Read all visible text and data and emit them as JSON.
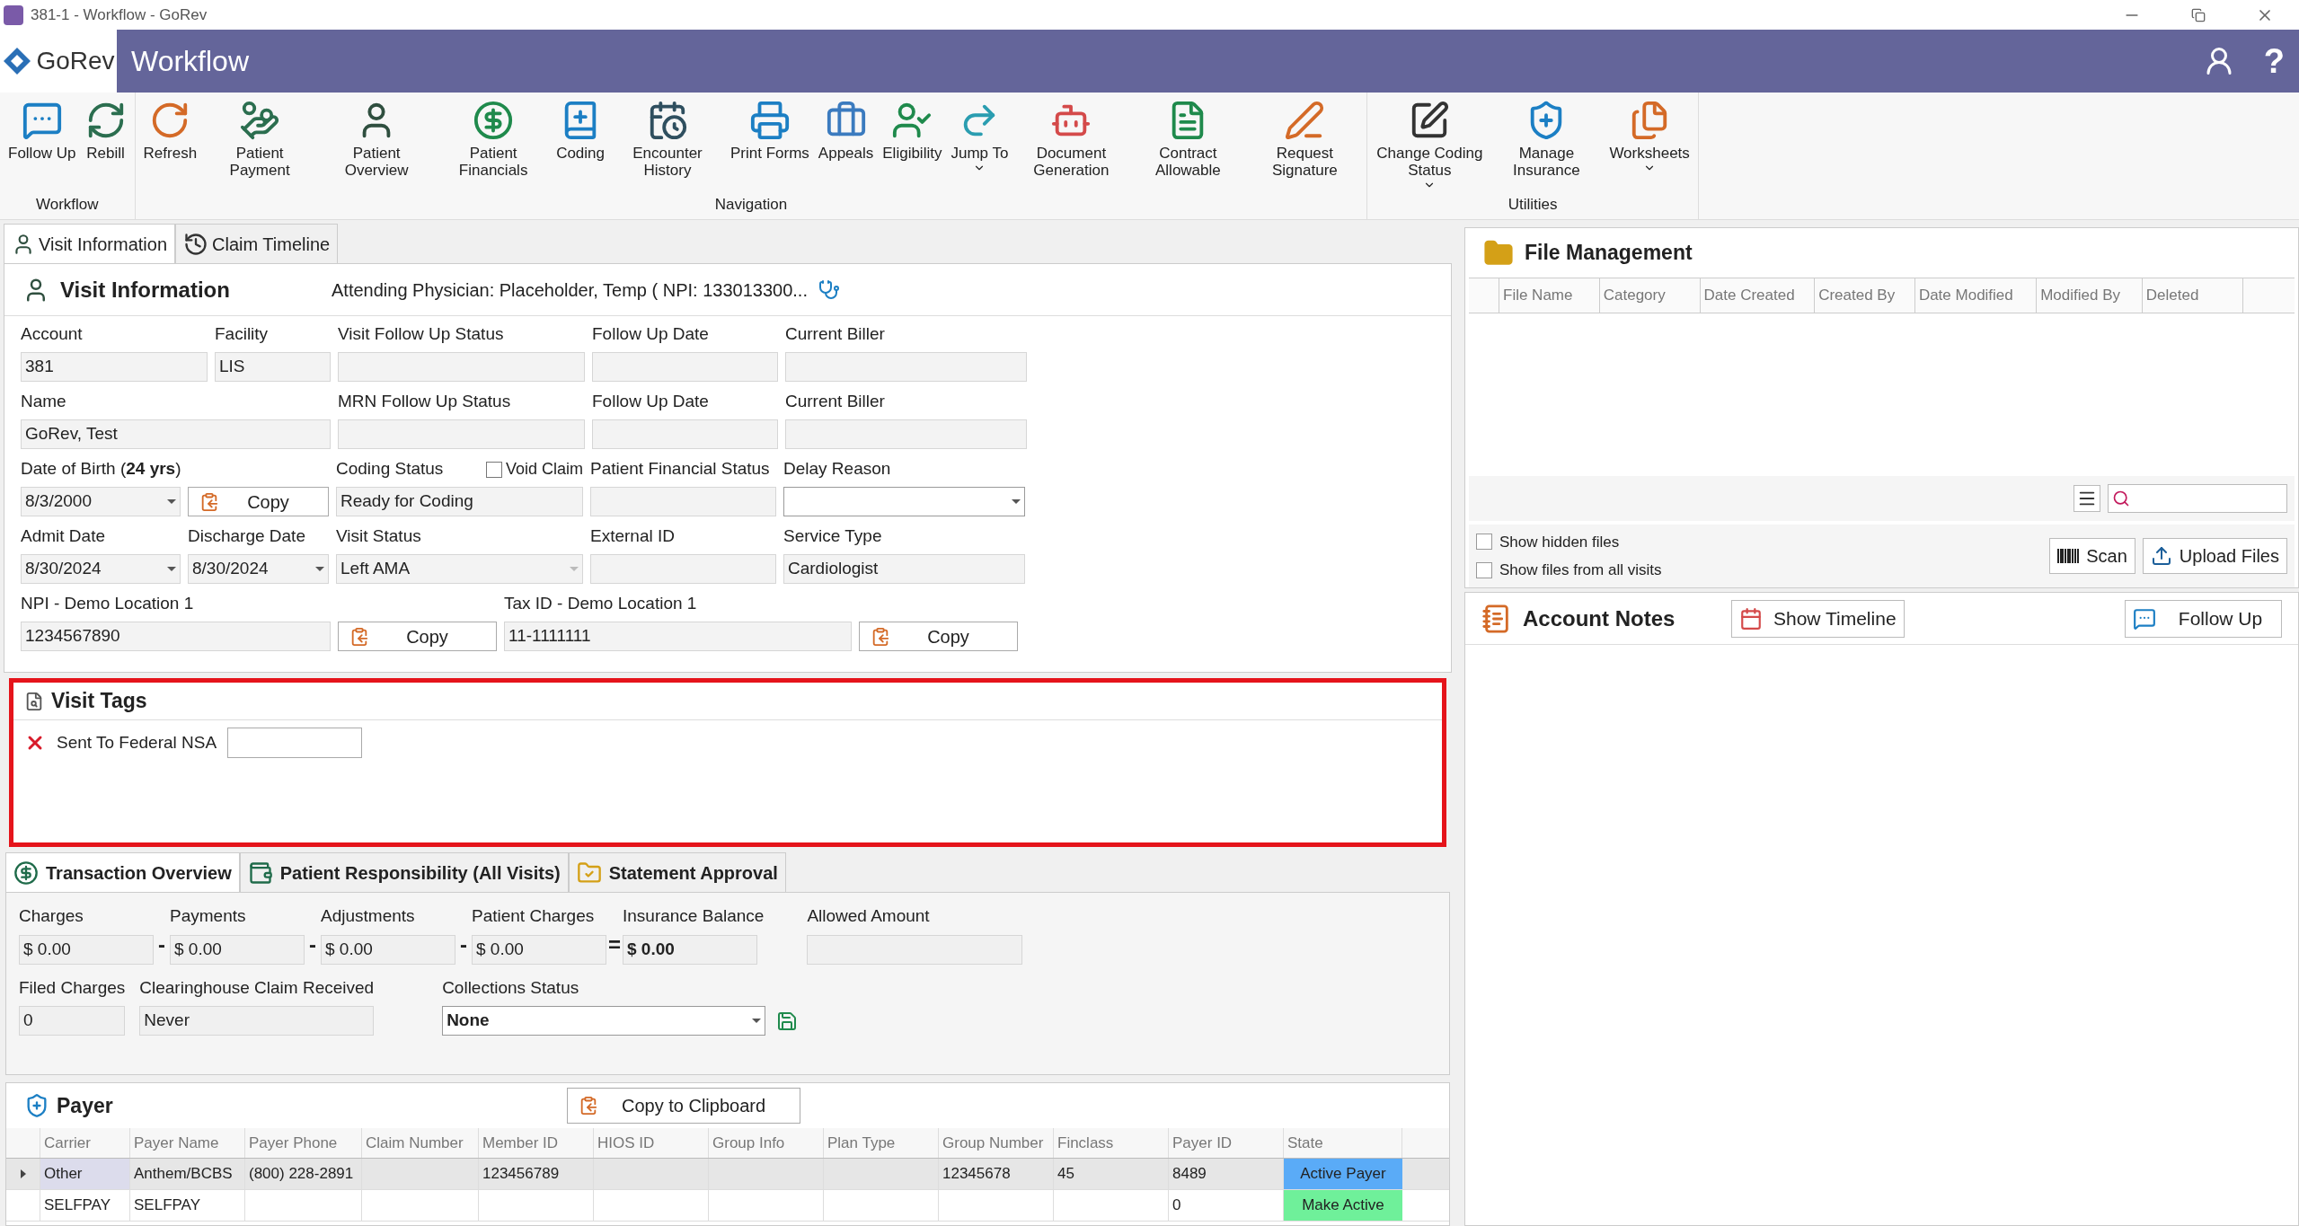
{
  "window": {
    "title": "381-1 - Workflow - GoRev"
  },
  "header": {
    "logo_text": "GoRev",
    "title": "Workflow",
    "help": "?"
  },
  "toolbar": [
    {
      "label": "Workflow",
      "items": [
        {
          "label": "Follow Up",
          "dropdown": false
        },
        {
          "label": "Rebill",
          "dropdown": false
        }
      ]
    },
    {
      "label": "Navigation",
      "items": [
        {
          "label": "Refresh",
          "dropdown": false
        },
        {
          "label": "Patient Payment",
          "dropdown": false
        },
        {
          "label": "Patient Overview",
          "dropdown": false
        },
        {
          "label": "Patient Financials",
          "dropdown": false
        },
        {
          "label": "Coding",
          "dropdown": false
        },
        {
          "label": "Encounter History",
          "dropdown": false
        },
        {
          "label": "Print Forms",
          "dropdown": false
        },
        {
          "label": "Appeals",
          "dropdown": false
        },
        {
          "label": "Eligibility",
          "dropdown": false
        },
        {
          "label": "Jump To",
          "dropdown": true
        },
        {
          "label": "Document Generation",
          "dropdown": false
        },
        {
          "label": "Contract Allowable",
          "dropdown": false
        },
        {
          "label": "Request Signature",
          "dropdown": false
        }
      ]
    },
    {
      "label": "Utilities",
      "items": [
        {
          "label": "Change Coding Status",
          "dropdown": true
        },
        {
          "label": "Manage Insurance",
          "dropdown": false
        },
        {
          "label": "Worksheets",
          "dropdown": true
        }
      ]
    }
  ],
  "tabs": [
    {
      "label": "Visit Information",
      "selected": true
    },
    {
      "label": "Claim Timeline",
      "selected": false
    }
  ],
  "visit_info": {
    "title": "Visit Information",
    "attending_physician": "Attending Physician: Placeholder, Temp ( NPI: 133013300...",
    "rows": [
      [
        {
          "kind": "text",
          "label": "Account",
          "value": "381"
        },
        {
          "kind": "text",
          "label": "Facility",
          "value": "LIS"
        },
        {
          "kind": "text",
          "label": "Visit Follow Up Status"
        },
        {
          "kind": "text",
          "label": "Follow Up Date"
        },
        {
          "kind": "text",
          "label": "Current Biller"
        }
      ],
      [
        {
          "kind": "text",
          "label": "Name",
          "value": "GoRev, Test"
        },
        "",
        {
          "kind": "text",
          "label": "MRN Follow Up Status"
        },
        {
          "kind": "text",
          "label": "Follow Up Date"
        },
        {
          "kind": "text",
          "label": "Current Biller"
        }
      ],
      [
        {
          "kind": "date",
          "label": "Date of Birth (**24 yrs**)",
          "value": "8/3/2000"
        },
        {
          "kind": "copy",
          "value": "Copy"
        },
        {
          "kind": "text",
          "label": "Coding Status",
          "value": "Ready for Coding",
          "checkbox": {
            "label": "Void Claim",
            "checked": false
          }
        },
        {
          "kind": "text",
          "label": "Patient Financial Status"
        },
        {
          "kind": "select",
          "label": "Delay Reason",
          "disabled": false
        }
      ],
      [
        {
          "kind": "date",
          "label": "Admit Date",
          "value": "8/30/2024"
        },
        {
          "kind": "date",
          "label": "Discharge Date",
          "value": "8/30/2024"
        },
        {
          "kind": "select",
          "label": "Visit Status",
          "value": "Left AMA",
          "disabled": true
        },
        {
          "kind": "text",
          "label": "External ID"
        },
        {
          "kind": "text",
          "label": "Service Type",
          "value": "Cardiologist"
        }
      ],
      [
        {
          "kind": "text",
          "label": "NPI - Demo Location 1",
          "value": "1234567890"
        },
        "",
        {
          "kind": "copy",
          "value": "Copy"
        },
        {
          "kind": "text",
          "label": "Tax ID - Demo Location 1",
          "value": "11-1111111"
        },
        {
          "kind": "copy",
          "value": "Copy"
        }
      ]
    ]
  },
  "visit_tags": {
    "title": "Visit Tags",
    "tags": [
      {
        "label": "Sent To Federal NSA"
      }
    ]
  },
  "bottom_tabs": [
    {
      "label": "Transaction Overview",
      "selected": true
    },
    {
      "label": "Patient Responsibility (All Visits)",
      "selected": false
    },
    {
      "label": "Statement Approval",
      "selected": false
    }
  ],
  "transactions": {
    "amounts": [
      {
        "label": "Charges",
        "value": "$ 0.00",
        "bold": false
      },
      {
        "op": "-",
        "label": "Payments",
        "value": "$ 0.00",
        "bold": false
      },
      {
        "op": "-",
        "label": "Adjustments",
        "value": "$ 0.00",
        "bold": false
      },
      {
        "op": "-",
        "label": "Patient Charges",
        "value": "$ 0.00",
        "bold": false
      },
      {
        "op": "=",
        "label": "Insurance Balance",
        "value": "$ 0.00",
        "bold": true
      },
      {
        "label": "Allowed Amount"
      }
    ],
    "filed_charges": {
      "label": "Filed Charges",
      "value": "0"
    },
    "clearinghouse": {
      "label": "Clearinghouse Claim Received",
      "value": "Never"
    },
    "collections": {
      "label": "Collections Status",
      "value": "None"
    }
  },
  "payer": {
    "title": "Payer",
    "copy_button": "Copy to Clipboard",
    "columns": [
      "Carrier",
      "Payer Name",
      "Payer Phone",
      "Claim Number",
      "Member ID",
      "HIOS ID",
      "Group Info",
      "Plan Type",
      "Group Number",
      "Finclass",
      "Payer ID",
      "State"
    ],
    "rows": [
      {
        "selected": true,
        "cells": [
          "Other",
          "Anthem/BCBS",
          "(800) 228-2891",
          "",
          "123456789",
          "",
          "",
          "",
          "12345678",
          "45",
          "8489"
        ],
        "state": {
          "label": "Active Payer",
          "color": "#5aabf7"
        }
      },
      {
        "selected": false,
        "cells": [
          "SELFPAY",
          "SELFPAY",
          "",
          "",
          "",
          "",
          "",
          "",
          "",
          "",
          "0"
        ],
        "state": {
          "label": "Make Active",
          "color": "#6ff09a"
        }
      }
    ]
  },
  "file_management": {
    "title": "File Management",
    "columns": [
      "File Name",
      "Category",
      "Date Created",
      "Created By",
      "Date Modified",
      "Modified By",
      "Deleted"
    ],
    "options": [
      {
        "label": "Show hidden files",
        "checked": false
      },
      {
        "label": "Show files from all visits",
        "checked": false
      }
    ],
    "buttons": [
      "Scan",
      "Upload Files"
    ]
  },
  "account_notes": {
    "title": "Account Notes",
    "timeline_button": "Show Timeline",
    "follow_up_button": "Follow Up"
  }
}
